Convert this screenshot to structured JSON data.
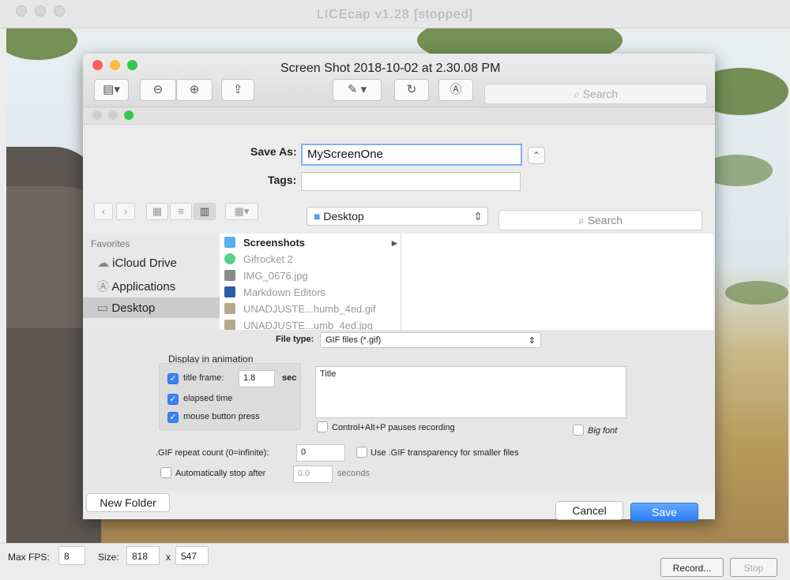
{
  "licecap": {
    "title": "LICEcap v1.28 [stopped]",
    "max_fps_label": "Max FPS:",
    "max_fps": "8",
    "size_label": "Size:",
    "width": "818",
    "x": "x",
    "height": "547",
    "record_label": "Record...",
    "stop_label": "Stop"
  },
  "preview": {
    "title": "Screen Shot 2018-10-02 at 2.30.08 PM",
    "search_placeholder": "Search"
  },
  "save": {
    "save_as_label": "Save As:",
    "save_as_value": "MyScreenOne",
    "tags_label": "Tags:",
    "location": "Desktop",
    "search_placeholder": "Search",
    "favorites_heading": "Favorites",
    "favorites": [
      "iCloud Drive",
      "Applications",
      "Desktop"
    ],
    "files": [
      "Screenshots",
      "Gifrocket 2",
      "IMG_0676.jpg",
      "Markdown Editors",
      "UNADJUSTE...humb_4ed.gif",
      "UNADJUSTE...umb_4ed.jpg"
    ],
    "file_type_label": "File type:",
    "file_type_value": "GIF files (*.gif)",
    "display_heading": "Display in animation",
    "title_frame_label": "title frame:",
    "title_frame_value": "1.8",
    "sec_label": "sec",
    "elapsed_label": "elapsed time",
    "mouse_label": "mouse button press",
    "title_box": "Title",
    "pause_label": "Control+Alt+P pauses recording",
    "big_font_label": "Big font",
    "repeat_label": ".GIF repeat count (0=infinite):",
    "repeat_value": "0",
    "transparency_label": "Use .GIF transparency for smaller files",
    "auto_stop_label": "Automatically stop after",
    "auto_stop_value": "0.0",
    "seconds_label": "seconds",
    "new_folder": "New Folder",
    "cancel": "Cancel",
    "save": "Save"
  },
  "colors": {
    "accent": "#2c7ff5"
  }
}
